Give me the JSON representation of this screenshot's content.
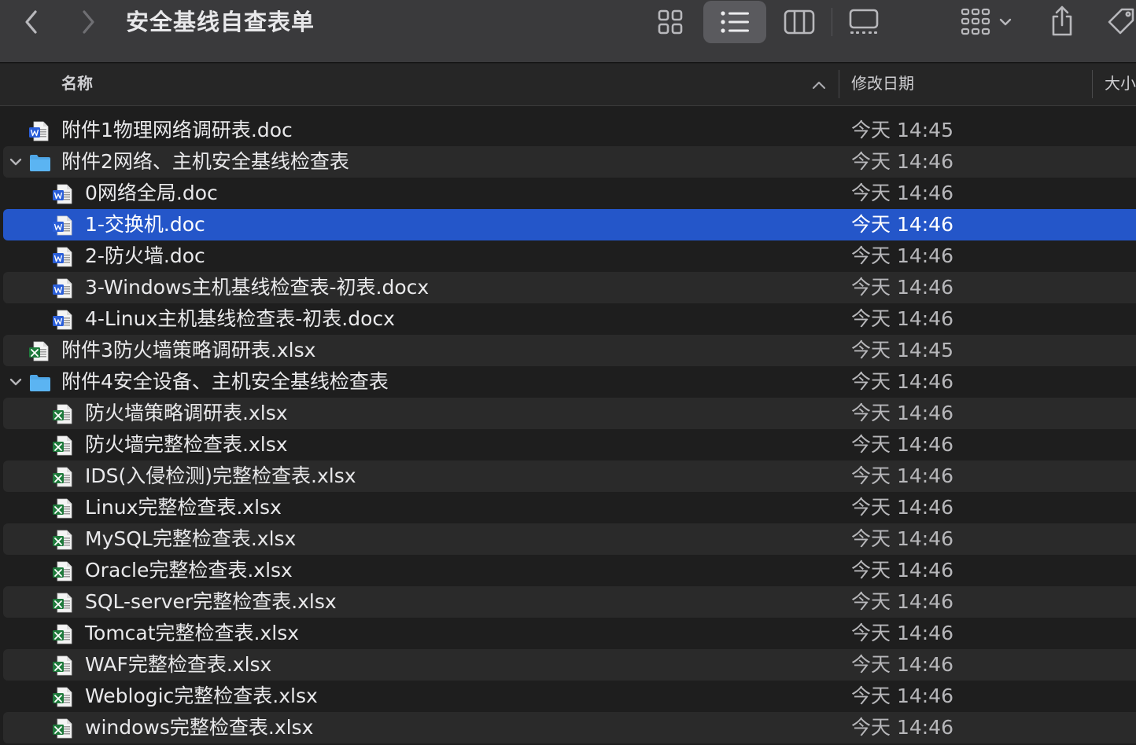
{
  "window": {
    "title": "安全基线自查表单"
  },
  "columns": {
    "name": "名称",
    "date": "修改日期",
    "size": "大小"
  },
  "colors": {
    "selection": "#2456c9",
    "folder": "#5bb4f2",
    "word": "#2b5fd9",
    "excel": "#1f7a3c"
  },
  "rows": [
    {
      "name": "附件1物理网络调研表.doc",
      "date": "今天 14:45",
      "kind": "word",
      "level": 0
    },
    {
      "name": "附件2网络、主机安全基线检查表",
      "date": "今天 14:46",
      "kind": "folder",
      "level": 0,
      "expanded": true
    },
    {
      "name": "0网络全局.doc",
      "date": "今天 14:46",
      "kind": "word",
      "level": 1
    },
    {
      "name": "1-交换机.doc",
      "date": "今天 14:46",
      "kind": "word",
      "level": 1,
      "selected": true
    },
    {
      "name": "2-防火墙.doc",
      "date": "今天 14:46",
      "kind": "word",
      "level": 1
    },
    {
      "name": "3-Windows主机基线检查表-初表.docx",
      "date": "今天 14:46",
      "kind": "word",
      "level": 1
    },
    {
      "name": "4-Linux主机基线检查表-初表.docx",
      "date": "今天 14:46",
      "kind": "word",
      "level": 1
    },
    {
      "name": "附件3防火墙策略调研表.xlsx",
      "date": "今天 14:45",
      "kind": "excel",
      "level": 0
    },
    {
      "name": "附件4安全设备、主机安全基线检查表",
      "date": "今天 14:46",
      "kind": "folder",
      "level": 0,
      "expanded": true
    },
    {
      "name": "防火墙策略调研表.xlsx",
      "date": "今天 14:46",
      "kind": "excel",
      "level": 1
    },
    {
      "name": "防火墙完整检查表.xlsx",
      "date": "今天 14:46",
      "kind": "excel",
      "level": 1
    },
    {
      "name": "IDS(入侵检测)完整检查表.xlsx",
      "date": "今天 14:46",
      "kind": "excel",
      "level": 1
    },
    {
      "name": "Linux完整检查表.xlsx",
      "date": "今天 14:46",
      "kind": "excel",
      "level": 1
    },
    {
      "name": "MySQL完整检查表.xlsx",
      "date": "今天 14:46",
      "kind": "excel",
      "level": 1
    },
    {
      "name": "Oracle完整检查表.xlsx",
      "date": "今天 14:46",
      "kind": "excel",
      "level": 1
    },
    {
      "name": "SQL-server完整检查表.xlsx",
      "date": "今天 14:46",
      "kind": "excel",
      "level": 1
    },
    {
      "name": "Tomcat完整检查表.xlsx",
      "date": "今天 14:46",
      "kind": "excel",
      "level": 1
    },
    {
      "name": "WAF完整检查表.xlsx",
      "date": "今天 14:46",
      "kind": "excel",
      "level": 1
    },
    {
      "name": "Weblogic完整检查表.xlsx",
      "date": "今天 14:46",
      "kind": "excel",
      "level": 1
    },
    {
      "name": "windows完整检查表.xlsx",
      "date": "今天 14:46",
      "kind": "excel",
      "level": 1
    }
  ]
}
